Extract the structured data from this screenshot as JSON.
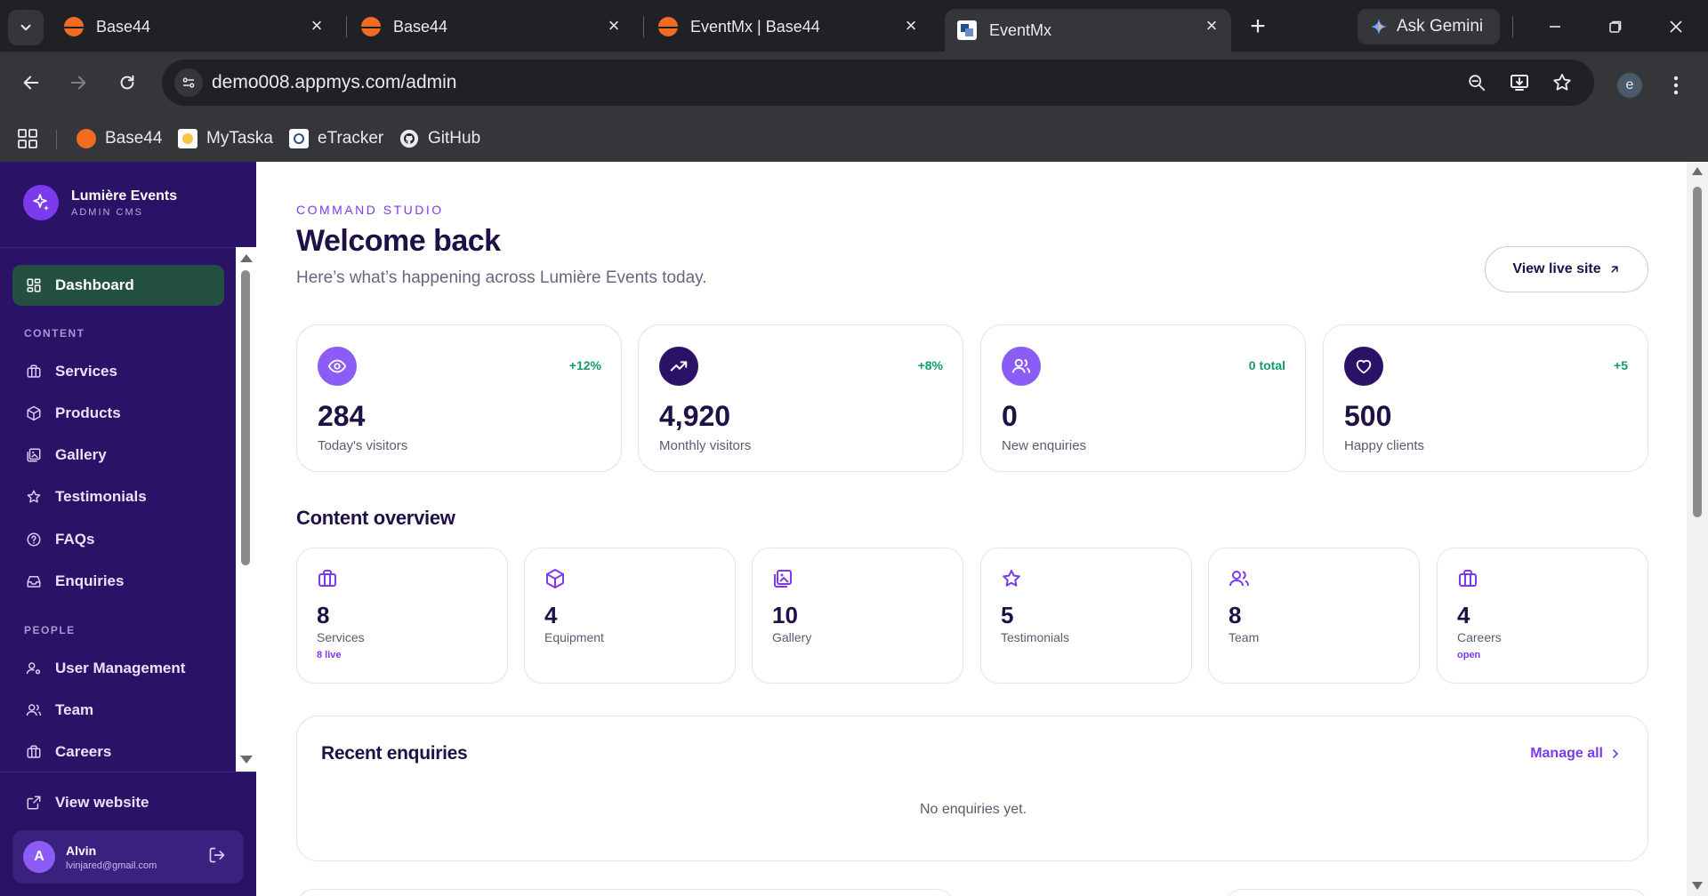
{
  "browser": {
    "tabs": [
      {
        "title": "Base44"
      },
      {
        "title": "Base44"
      },
      {
        "title": "EventMx | Base44"
      },
      {
        "title": "EventMx"
      }
    ],
    "gemini_label": "Ask Gemini",
    "url": "demo008.appmys.com/admin",
    "profile_initial": "e",
    "bookmarks": [
      {
        "label": "Base44"
      },
      {
        "label": "MyTaska"
      },
      {
        "label": "eTracker"
      },
      {
        "label": "GitHub"
      }
    ]
  },
  "sidebar": {
    "brand_name": "Lumière Events",
    "brand_sub": "ADMIN CMS",
    "dashboard_label": "Dashboard",
    "content_section": "CONTENT",
    "content_items": [
      {
        "label": "Services",
        "icon": "briefcase-icon"
      },
      {
        "label": "Products",
        "icon": "box-icon"
      },
      {
        "label": "Gallery",
        "icon": "image-icon"
      },
      {
        "label": "Testimonials",
        "icon": "star-icon"
      },
      {
        "label": "FAQs",
        "icon": "help-circle-icon"
      },
      {
        "label": "Enquiries",
        "icon": "inbox-icon"
      }
    ],
    "people_section": "PEOPLE",
    "people_items": [
      {
        "label": "User Management",
        "icon": "user-cog-icon"
      },
      {
        "label": "Team",
        "icon": "users-icon"
      },
      {
        "label": "Careers",
        "icon": "briefcase-icon"
      }
    ],
    "view_website": "View website",
    "user": {
      "initial": "A",
      "name": "Alvin",
      "email": "lvinjared@gmail.com"
    }
  },
  "main": {
    "eyebrow": "COMMAND STUDIO",
    "title": "Welcome back",
    "subtitle": "Here’s what’s happening across Lumière Events today.",
    "live_button": "View live site",
    "stats": [
      {
        "value": "284",
        "label": "Today's visitors",
        "delta": "+12%",
        "icon": "eye-icon",
        "color": "#8b5cf6"
      },
      {
        "value": "4,920",
        "label": "Monthly visitors",
        "delta": "+8%",
        "icon": "trending-up-icon",
        "color": "#2a1266"
      },
      {
        "value": "0",
        "label": "New enquiries",
        "delta": "0 total",
        "icon": "users-icon",
        "color": "#8b5cf6"
      },
      {
        "value": "500",
        "label": "Happy clients",
        "delta": "+5",
        "icon": "heart-icon",
        "color": "#2a1266"
      }
    ],
    "overview_title": "Content overview",
    "overview": [
      {
        "value": "8",
        "label": "Services",
        "note": "8 live",
        "icon": "briefcase-icon"
      },
      {
        "value": "4",
        "label": "Equipment",
        "note": "",
        "icon": "box-icon"
      },
      {
        "value": "10",
        "label": "Gallery",
        "note": "",
        "icon": "image-icon"
      },
      {
        "value": "5",
        "label": "Testimonials",
        "note": "",
        "icon": "star-icon"
      },
      {
        "value": "8",
        "label": "Team",
        "note": "",
        "icon": "users-icon"
      },
      {
        "value": "4",
        "label": "Careers",
        "note": "open",
        "icon": "briefcase-icon"
      }
    ],
    "recent_title": "Recent enquiries",
    "manage_all": "Manage all",
    "empty_message": "No enquiries yet."
  },
  "colors": {
    "sidebar_bg": "#2a1266",
    "active_nav": "#245041",
    "accent": "#7c3aed",
    "heading": "#1f1048",
    "positive": "#149a6d"
  }
}
